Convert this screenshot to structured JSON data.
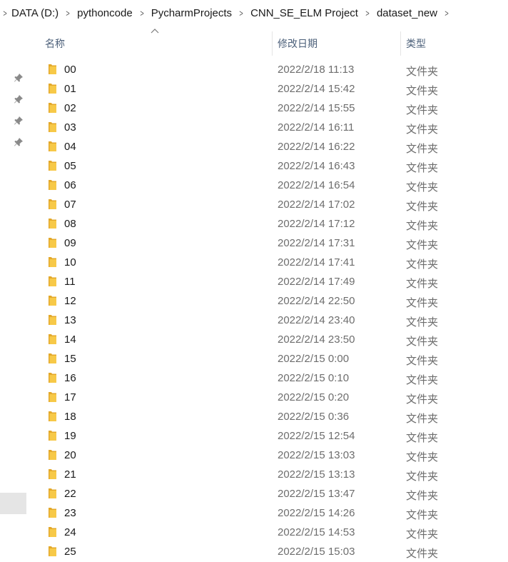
{
  "breadcrumb": {
    "items": [
      "DATA (D:)",
      "pythoncode",
      "PycharmProjects",
      "CNN_SE_ELM Project",
      "dataset_new"
    ]
  },
  "columns": {
    "name": "名称",
    "date": "修改日期",
    "type": "类型"
  },
  "colors": {
    "folder": "#f7c948",
    "folder_dark": "#e3a82a",
    "header_text": "#4c607a",
    "secondary_text": "#6d6d6d"
  },
  "files": [
    {
      "name": "00",
      "date": "2022/2/18 11:13",
      "type": "文件夹"
    },
    {
      "name": "01",
      "date": "2022/2/14 15:42",
      "type": "文件夹"
    },
    {
      "name": "02",
      "date": "2022/2/14 15:55",
      "type": "文件夹"
    },
    {
      "name": "03",
      "date": "2022/2/14 16:11",
      "type": "文件夹"
    },
    {
      "name": "04",
      "date": "2022/2/14 16:22",
      "type": "文件夹"
    },
    {
      "name": "05",
      "date": "2022/2/14 16:43",
      "type": "文件夹"
    },
    {
      "name": "06",
      "date": "2022/2/14 16:54",
      "type": "文件夹"
    },
    {
      "name": "07",
      "date": "2022/2/14 17:02",
      "type": "文件夹"
    },
    {
      "name": "08",
      "date": "2022/2/14 17:12",
      "type": "文件夹"
    },
    {
      "name": "09",
      "date": "2022/2/14 17:31",
      "type": "文件夹"
    },
    {
      "name": "10",
      "date": "2022/2/14 17:41",
      "type": "文件夹"
    },
    {
      "name": "11",
      "date": "2022/2/14 17:49",
      "type": "文件夹"
    },
    {
      "name": "12",
      "date": "2022/2/14 22:50",
      "type": "文件夹"
    },
    {
      "name": "13",
      "date": "2022/2/14 23:40",
      "type": "文件夹"
    },
    {
      "name": "14",
      "date": "2022/2/14 23:50",
      "type": "文件夹"
    },
    {
      "name": "15",
      "date": "2022/2/15 0:00",
      "type": "文件夹"
    },
    {
      "name": "16",
      "date": "2022/2/15 0:10",
      "type": "文件夹"
    },
    {
      "name": "17",
      "date": "2022/2/15 0:20",
      "type": "文件夹"
    },
    {
      "name": "18",
      "date": "2022/2/15 0:36",
      "type": "文件夹"
    },
    {
      "name": "19",
      "date": "2022/2/15 12:54",
      "type": "文件夹"
    },
    {
      "name": "20",
      "date": "2022/2/15 13:03",
      "type": "文件夹"
    },
    {
      "name": "21",
      "date": "2022/2/15 13:13",
      "type": "文件夹"
    },
    {
      "name": "22",
      "date": "2022/2/15 13:47",
      "type": "文件夹"
    },
    {
      "name": "23",
      "date": "2022/2/15 14:26",
      "type": "文件夹"
    },
    {
      "name": "24",
      "date": "2022/2/15 14:53",
      "type": "文件夹"
    },
    {
      "name": "25",
      "date": "2022/2/15 15:03",
      "type": "文件夹"
    }
  ]
}
